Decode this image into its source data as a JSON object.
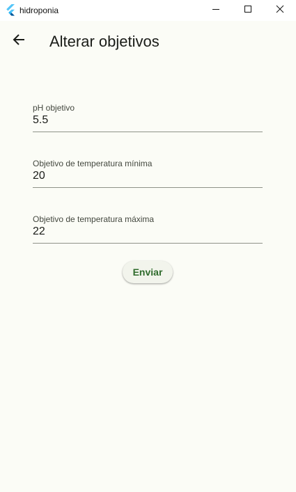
{
  "window": {
    "title": "hidroponia",
    "icon": "flutter-logo-icon",
    "controls": [
      "minimize-icon",
      "maximize-icon",
      "close-icon"
    ]
  },
  "appbar": {
    "back_icon": "arrow-left-icon",
    "title": "Alterar objetivos"
  },
  "form": {
    "fields": [
      {
        "label": "pH objetivo",
        "value": "5.5"
      },
      {
        "label": "Objetivo de temperatura mínima",
        "value": "20"
      },
      {
        "label": "Objetivo de temperatura máxima",
        "value": "22"
      }
    ],
    "submit_label": "Enviar"
  },
  "colors": {
    "background": "#fbfcf6",
    "titlebar": "#ffffff",
    "accent": "#2f6b2c",
    "underline": "#8e9288",
    "flutter_blue_light": "#54c5f8",
    "flutter_blue_dark": "#01579b"
  }
}
